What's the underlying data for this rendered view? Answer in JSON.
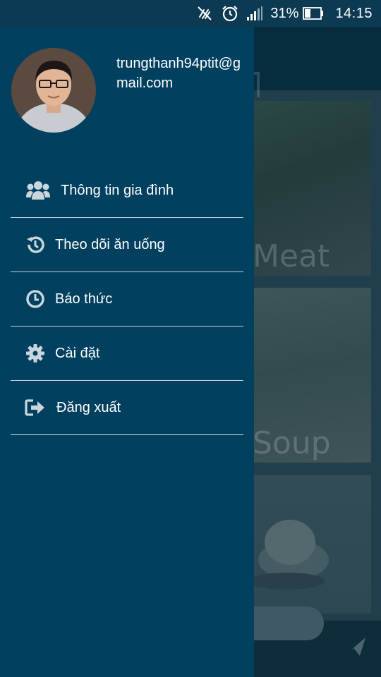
{
  "status_bar": {
    "battery_percent": "31%",
    "time": "14:15",
    "icons": [
      "no-sync-icon",
      "alarm-clock-icon",
      "signal-icon",
      "battery-icon"
    ]
  },
  "background_app": {
    "cards": [
      {
        "title": "Meat"
      },
      {
        "title": "Soup"
      },
      {
        "title": ""
      }
    ]
  },
  "drawer": {
    "email": "trungthanh94ptit@gmail.com",
    "items": [
      {
        "label": "Thông tin gia đình",
        "icon": "family-icon"
      },
      {
        "label": "Theo dõi ăn uống",
        "icon": "history-icon"
      },
      {
        "label": "Báo thức",
        "icon": "clock-icon"
      },
      {
        "label": "Cài đặt",
        "icon": "gear-icon"
      },
      {
        "label": "Đăng xuất",
        "icon": "logout-icon"
      }
    ]
  },
  "colors": {
    "drawer_bg": "#024060",
    "status_bar_bg": "#0b3a52",
    "divider": "#c8d3da",
    "icon": "#c9d6de"
  }
}
